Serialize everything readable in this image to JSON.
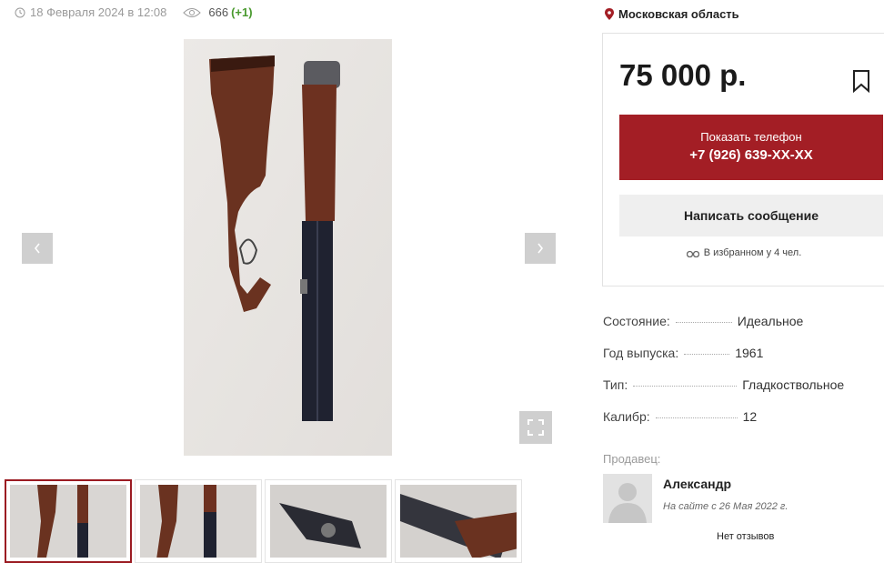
{
  "listing": {
    "date": "18 Февраля 2024 в 12:08",
    "views": "666",
    "views_delta": "(+1)"
  },
  "location": "Московская область",
  "price": "75 000 р.",
  "buttons": {
    "phone_label": "Показать телефон",
    "phone_number": "+7 (926) 639-XX-XX",
    "message": "Написать сообщение"
  },
  "favorites": "В избранном у 4 чел.",
  "specs": [
    {
      "label": "Состояние:",
      "value": "Идеальное"
    },
    {
      "label": "Год выпуска:",
      "value": "1961"
    },
    {
      "label": "Тип:",
      "value": "Гладкоствольное"
    },
    {
      "label": "Калибр:",
      "value": "12"
    }
  ],
  "seller": {
    "label": "Продавец:",
    "name": "Александр",
    "since": "На сайте с 26 Мая 2022 г.",
    "reviews": "Нет отзывов"
  },
  "icons": {
    "clock": "clock-icon",
    "eye": "eye-icon",
    "pin": "location-pin-icon",
    "bookmark": "bookmark-icon",
    "binoculars": "binoculars-icon",
    "fullscreen": "fullscreen-icon"
  },
  "colors": {
    "accent": "#a31e25",
    "views_delta": "#4a9a2f",
    "muted": "#9a9a9a"
  }
}
